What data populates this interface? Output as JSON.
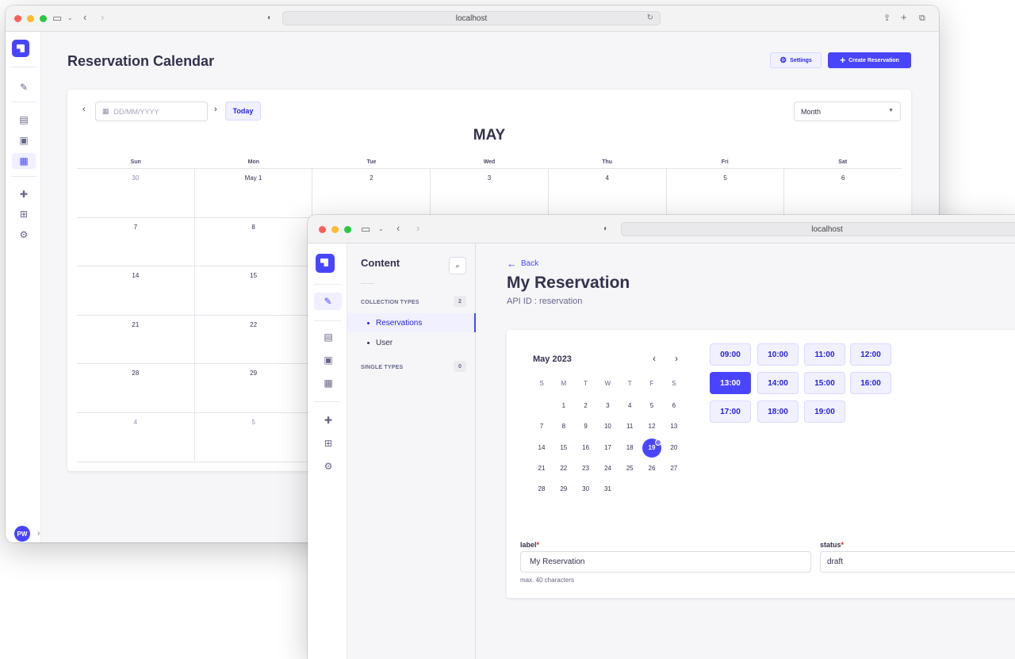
{
  "browser": {
    "address": "localhost"
  },
  "calendar_app": {
    "title": "Reservation Calendar",
    "settings_label": "Settings",
    "create_label": "Create Reservation",
    "date_placeholder": "DD/MM/YYYY",
    "today_label": "Today",
    "view_select": "Month",
    "month_label": "MAY",
    "weekdays": [
      "Sun",
      "Mon",
      "Tue",
      "Wed",
      "Thu",
      "Fri",
      "Sat"
    ],
    "weeks": [
      [
        "30",
        "May 1",
        "2",
        "3",
        "4",
        "5",
        "6"
      ],
      [
        "7",
        "8",
        "",
        "",
        "",
        "",
        ""
      ],
      [
        "14",
        "15",
        "",
        "",
        "",
        "",
        ""
      ],
      [
        "21",
        "22",
        "",
        "",
        "",
        "",
        ""
      ],
      [
        "28",
        "29",
        "",
        "",
        "",
        "",
        ""
      ],
      [
        "4",
        "5",
        "",
        "",
        "",
        "",
        ""
      ]
    ],
    "avatar": "PW"
  },
  "content_app": {
    "sidebar_title": "Content",
    "collection_types_label": "COLLECTION TYPES",
    "collection_types_count": "2",
    "collection_items": [
      "Reservations",
      "User"
    ],
    "single_types_label": "SINGLE TYPES",
    "single_types_count": "0",
    "back_label": "Back",
    "entry_title": "My Reservation",
    "api_id": "API ID : reservation",
    "mini_calendar": {
      "month_label": "May 2023",
      "weekdays": [
        "S",
        "M",
        "T",
        "W",
        "T",
        "F",
        "S"
      ],
      "days": [
        "1",
        "2",
        "3",
        "4",
        "5",
        "6",
        "7",
        "8",
        "9",
        "10",
        "11",
        "12",
        "13",
        "14",
        "15",
        "16",
        "17",
        "18",
        "19",
        "20",
        "21",
        "22",
        "23",
        "24",
        "25",
        "26",
        "27",
        "28",
        "29",
        "30",
        "31"
      ],
      "selected_day": "19"
    },
    "time_slots": [
      "09:00",
      "10:00",
      "11:00",
      "12:00",
      "13:00",
      "14:00",
      "15:00",
      "16:00",
      "17:00",
      "18:00",
      "19:00"
    ],
    "selected_slot": "13:00",
    "label_field": {
      "label": "label",
      "value": "My Reservation",
      "hint": "max. 40 characters"
    },
    "status_field": {
      "label": "status",
      "value": "draft"
    }
  },
  "colors": {
    "accent": "#4945ff",
    "accent_light": "#f0f0ff"
  }
}
